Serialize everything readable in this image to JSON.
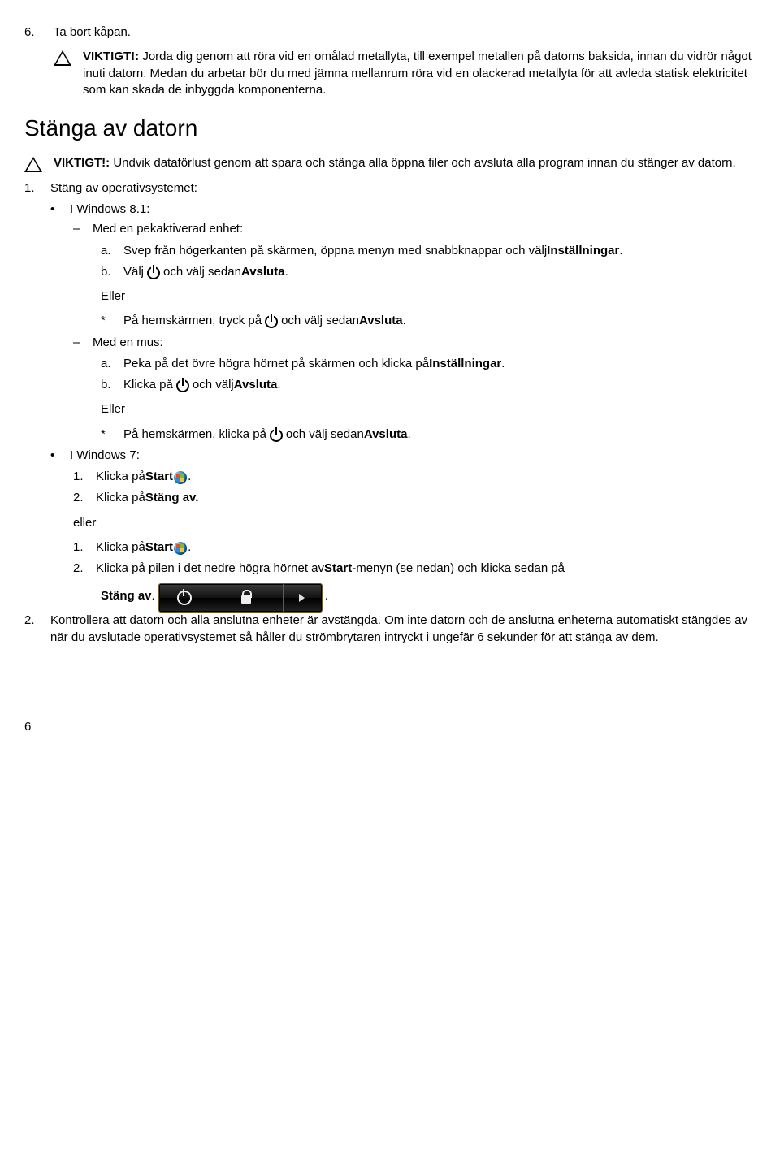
{
  "step6": {
    "num": "6.",
    "text": "Ta bort kåpan."
  },
  "caution1": {
    "label": "VIKTIGT!: ",
    "text": "Jorda dig genom att röra vid en omålad metallyta, till exempel metallen på datorns baksida, innan du vidrör något inuti datorn. Medan du arbetar bör du med jämna mellanrum röra vid en olackerad metallyta för att avleda statisk elektricitet som kan skada de inbyggda komponenterna."
  },
  "section_title": "Stänga av datorn",
  "caution2": {
    "label": "VIKTIGT!: ",
    "text": "Undvik dataförlust genom att spara och stänga alla öppna filer och avsluta alla program innan du stänger av datorn."
  },
  "s1": {
    "num": "1.",
    "text": "Stäng av operativsystemet:"
  },
  "win81": "I Windows 8.1:",
  "touch": "Med en pekaktiverad enhet:",
  "a1_pre": "Svep från högerkanten på skärmen, öppna menyn med snabbknappar och välj ",
  "a1_bold": "Inställningar",
  "a1_post": ".",
  "b1_pre": "Välj ",
  "b1_mid": " och välj sedan ",
  "b1_bold": "Avsluta",
  "b1_post": ".",
  "eller": "Eller",
  "star1_pre": "På hemskärmen, tryck på ",
  "star1_mid": " och välj sedan ",
  "star1_bold": "Avsluta",
  "star1_post": ".",
  "mouse": "Med en mus:",
  "a2_pre": "Peka på det övre högra hörnet på skärmen och klicka på ",
  "a2_bold": "Inställningar",
  "a2_post": ".",
  "b2_pre": "Klicka på ",
  "b2_mid": " och välj ",
  "b2_bold": "Avsluta",
  "b2_post": ".",
  "star2_pre": "På hemskärmen, klicka på ",
  "star2_mid": " och välj sedan ",
  "star2_bold": "Avsluta",
  "star2_post": ".",
  "win7": "I Windows 7:",
  "w7_1_pre": "Klicka på ",
  "w7_1_bold": "Start",
  "w7_1_post": " .",
  "w7_2_pre": "Klicka på ",
  "w7_2_bold": "Stäng av.",
  "eller_lower": "eller",
  "w7b_1_pre": "Klicka på ",
  "w7b_1_bold": "Start",
  "w7b_1_post": " .",
  "w7b_2_pre": "Klicka på pilen i det nedre högra hörnet av ",
  "w7b_2_bold": "Start",
  "w7b_2_post": "-menyn (se nedan) och klicka sedan på",
  "stangav_bold": "Stäng av ",
  "stangav_post": ".",
  "final_dot": ".",
  "s2": {
    "num": "2.",
    "text": "Kontrollera att datorn och alla anslutna enheter är avstängda. Om inte datorn och de anslutna enheterna automatiskt stängdes av när du avslutade operativsystemet så håller du strömbrytaren intryckt i ungefär 6 sekunder för att stänga av dem."
  },
  "page_num": "6",
  "letters": {
    "a": "a.",
    "b": "b."
  },
  "nums": {
    "one": "1.",
    "two": "2."
  },
  "bullet": "•",
  "dash": "–",
  "star": "*"
}
